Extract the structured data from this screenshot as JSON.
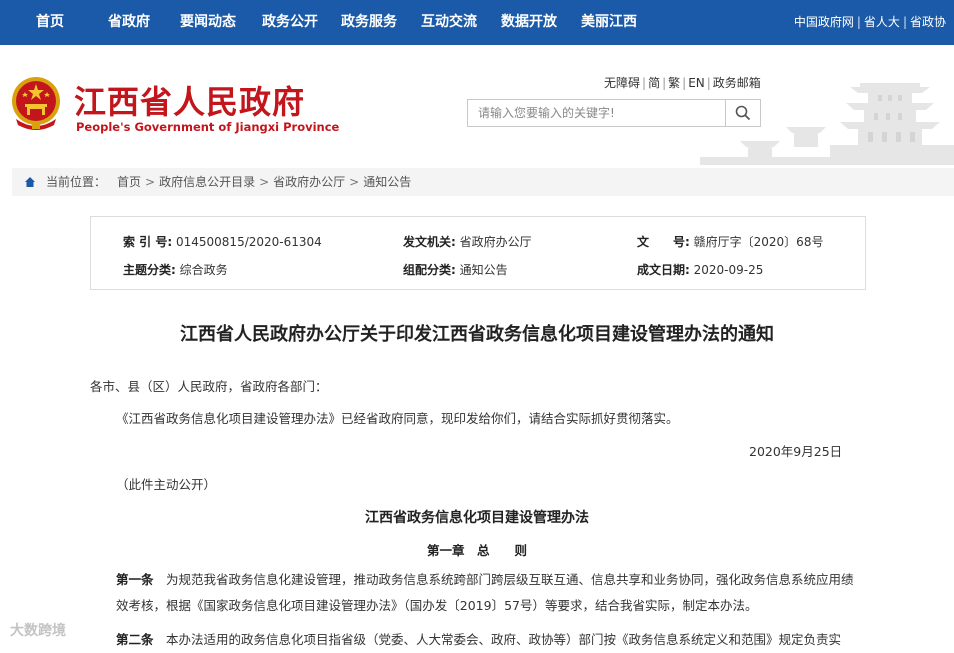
{
  "topnav": {
    "items": [
      "首页",
      "省政府",
      "要闻动态",
      "政务公开",
      "政务服务",
      "互动交流",
      "数据开放",
      "美丽江西"
    ],
    "right_links": [
      "中国政府网",
      "省人大",
      "省政协"
    ]
  },
  "header": {
    "title": "江西省人民政府",
    "subtitle": "People's Government of Jiangxi Province",
    "util_links": [
      "无障碍",
      "简",
      "繁",
      "EN",
      "政务邮箱"
    ],
    "search_placeholder": "请输入您要输入的关键字!"
  },
  "breadcrumb": {
    "label": "当前位置：",
    "items": [
      "首页",
      "政府信息公开目录",
      "省政府办公厅",
      "通知公告"
    ]
  },
  "meta": {
    "index_label": "索 引 号:",
    "index_value": "014500815/2020-61304",
    "issuer_label": "发文机关:",
    "issuer_value": "省政府办公厅",
    "docno_label": "文　　号:",
    "docno_value": "赣府厅字〔2020〕68号",
    "topic_label": "主题分类:",
    "topic_value": "综合政务",
    "category_label": "组配分类:",
    "category_value": "通知公告",
    "date_label": "成文日期:",
    "date_value": "2020-09-25"
  },
  "doc": {
    "title": "江西省人民政府办公厅关于印发江西省政务信息化项目建设管理办法的通知",
    "salutation": "各市、县（区）人民政府，省政府各部门：",
    "body": "《江西省政务信息化项目建设管理办法》已经省政府同意，现印发给你们，请结合实际抓好贯彻落实。",
    "date": "2020年9月25日",
    "public_note": "（此件主动公开）",
    "sub_title": "江西省政务信息化项目建设管理办法",
    "chapter1": "第一章　总　　则",
    "art1_label": "第一条",
    "art1_text": "　为规范我省政务信息化建设管理，推动政务信息系统跨部门跨层级互联互通、信息共享和业务协同，强化政务信息系统应用绩效考核，根据《国家政务信息化项目建设管理办法》（国办发〔2019〕57号）等要求，结合我省实际，制定本办法。",
    "art2_label": "第二条",
    "art2_text": "　本办法适用的政务信息化项目指省级（党委、人大常委会、政府、政协等）部门按《政务信息系统定义和范围》规定负责实"
  },
  "watermark": "大数跨境",
  "colors": {
    "nav_bg": "#1a5aa8",
    "title_red": "#c3161c"
  }
}
